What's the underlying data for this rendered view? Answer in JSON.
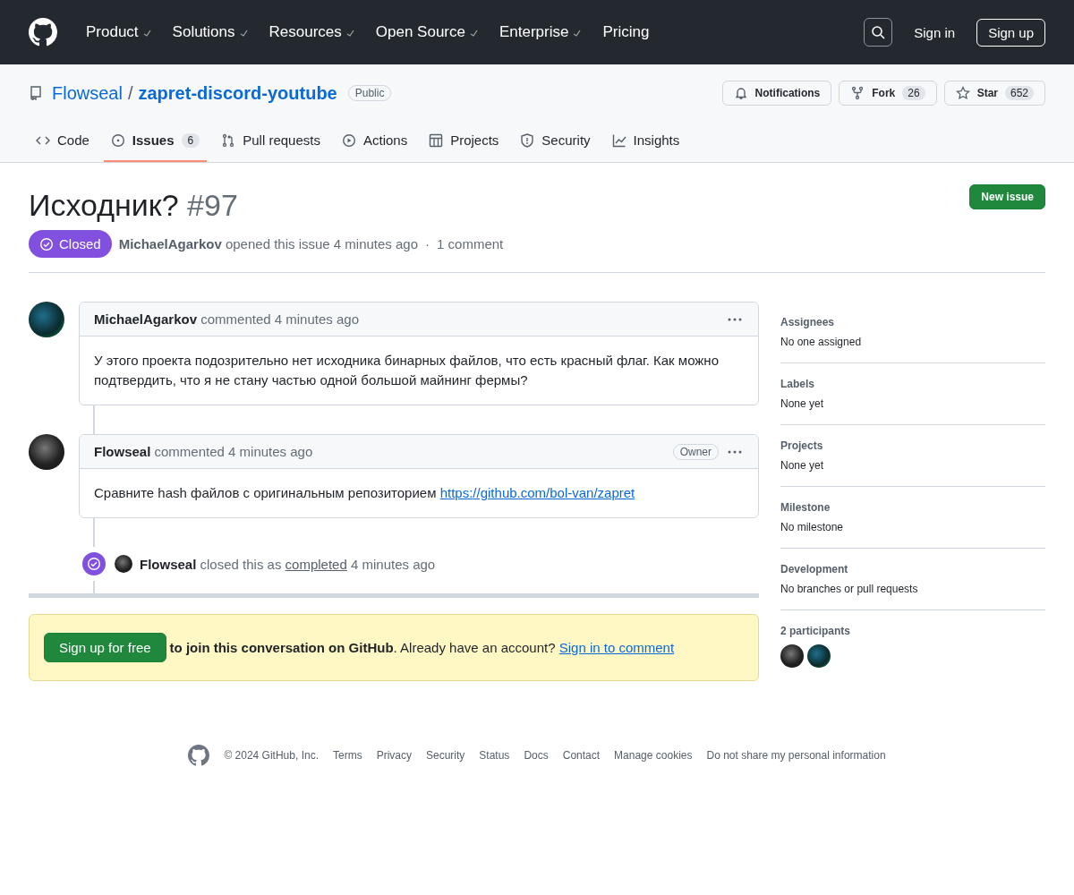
{
  "header": {
    "nav": [
      {
        "label": "Product",
        "dropdown": true
      },
      {
        "label": "Solutions",
        "dropdown": true
      },
      {
        "label": "Resources",
        "dropdown": true
      },
      {
        "label": "Open Source",
        "dropdown": true
      },
      {
        "label": "Enterprise",
        "dropdown": true
      },
      {
        "label": "Pricing",
        "dropdown": false
      }
    ],
    "sign_in": "Sign in",
    "sign_up": "Sign up"
  },
  "repo": {
    "owner": "Flowseal",
    "separator": "/",
    "name": "zapret-discord-youtube",
    "visibility": "Public",
    "actions": [
      {
        "kind": "bell",
        "label": "Notifications"
      },
      {
        "kind": "fork",
        "label": "Fork",
        "count": "26"
      },
      {
        "kind": "star",
        "label": "Star",
        "count": "652"
      }
    ]
  },
  "tabs": [
    {
      "kind": "code",
      "label": "Code",
      "selected": false
    },
    {
      "kind": "issues",
      "label": "Issues",
      "count": "6",
      "selected": true
    },
    {
      "kind": "pulls",
      "label": "Pull requests",
      "selected": false
    },
    {
      "kind": "actions",
      "label": "Actions",
      "selected": false
    },
    {
      "kind": "projects",
      "label": "Projects",
      "selected": false
    },
    {
      "kind": "security",
      "label": "Security",
      "selected": false
    },
    {
      "kind": "insights",
      "label": "Insights",
      "selected": false
    }
  ],
  "issue": {
    "title": "Исходник?",
    "number": "#97",
    "new_issue": "New issue",
    "state": "Closed",
    "author": "MichaelAgarkov",
    "opened": "opened this issue 4 minutes ago",
    "dot": "·",
    "comments_count": "1 comment"
  },
  "comments": [
    {
      "avatar": {
        "kind": "neon"
      },
      "author": "MichaelAgarkov",
      "action": "commented 4 minutes ago",
      "body": "У этого проекта подозрительно нет исходника бинарных файлов, что есть красный флаг. Как можно подтвердить, что я не стану частью одной большой майнинг фермы?"
    },
    {
      "avatar": {
        "kind": "dark"
      },
      "author": "Flowseal",
      "action": "commented 4 minutes ago",
      "role": "Owner",
      "body": "Сравните hash файлов с оригинальным репозиторием",
      "link": "https://github.com/bol-van/zapret"
    }
  ],
  "event": {
    "avatar": {
      "kind": "dark"
    },
    "actor": "Flowseal",
    "before": "closed this as",
    "reason": "completed",
    "after": "4 minutes ago"
  },
  "signup": {
    "button": "Sign up for free",
    "bold": "to join this conversation on GitHub",
    "text": ". Already have an account?",
    "link": "Sign in to comment"
  },
  "sidebar": [
    {
      "heading": "Assignees",
      "value": "No one assigned"
    },
    {
      "heading": "Labels",
      "value": "None yet"
    },
    {
      "heading": "Projects",
      "value": "None yet"
    },
    {
      "heading": "Milestone",
      "value": "No milestone"
    },
    {
      "heading": "Development",
      "value": "No branches or pull requests"
    }
  ],
  "participants": {
    "heading": "2 participants",
    "avatars": [
      {
        "kind": "dark"
      },
      {
        "kind": "neon"
      }
    ]
  },
  "footer": {
    "copyright": "© 2024 GitHub, Inc.",
    "links": [
      "Terms",
      "Privacy",
      "Security",
      "Status",
      "Docs",
      "Contact",
      "Manage cookies",
      "Do not share my personal information"
    ]
  }
}
